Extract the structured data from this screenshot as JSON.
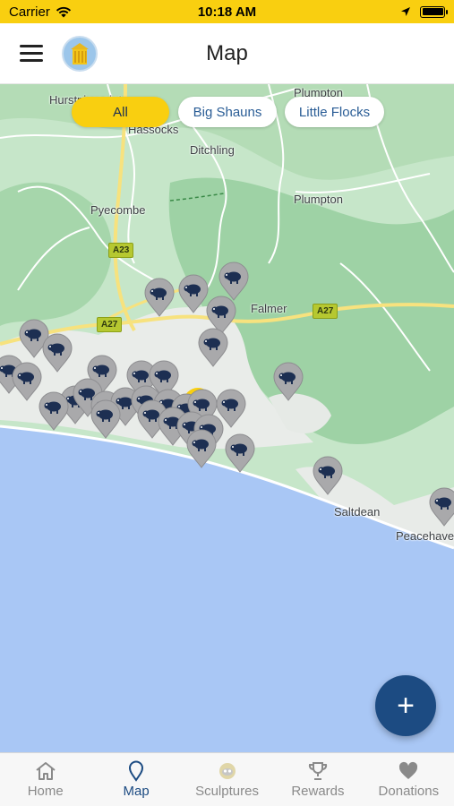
{
  "status": {
    "carrier": "Carrier",
    "time": "10:18 AM"
  },
  "header": {
    "title": "Map"
  },
  "filters": [
    {
      "label": "All",
      "active": true
    },
    {
      "label": "Big Shauns",
      "active": false
    },
    {
      "label": "Little Flocks",
      "active": false
    }
  ],
  "map": {
    "places": [
      "Plumpton",
      "Hurstpierpoint",
      "Hassocks",
      "Ditchling",
      "Plumpton",
      "Pyecombe",
      "Falmer",
      "Saltdean",
      "Peacehaven"
    ],
    "roads": [
      "A23",
      "A27",
      "A27"
    ]
  },
  "fab": {
    "label": "+"
  },
  "tabs": [
    {
      "label": "Home",
      "icon": "home-icon",
      "active": false
    },
    {
      "label": "Map",
      "icon": "map-pin-icon",
      "active": true
    },
    {
      "label": "Sculptures",
      "icon": "sheep-icon",
      "active": false
    },
    {
      "label": "Rewards",
      "icon": "trophy-icon",
      "active": false
    },
    {
      "label": "Donations",
      "icon": "heart-icon",
      "active": false
    }
  ],
  "colors": {
    "accent": "#f9cf10",
    "primary": "#1c4b82",
    "pin": "#a9a9ab",
    "sea": "#a9c7f5"
  }
}
